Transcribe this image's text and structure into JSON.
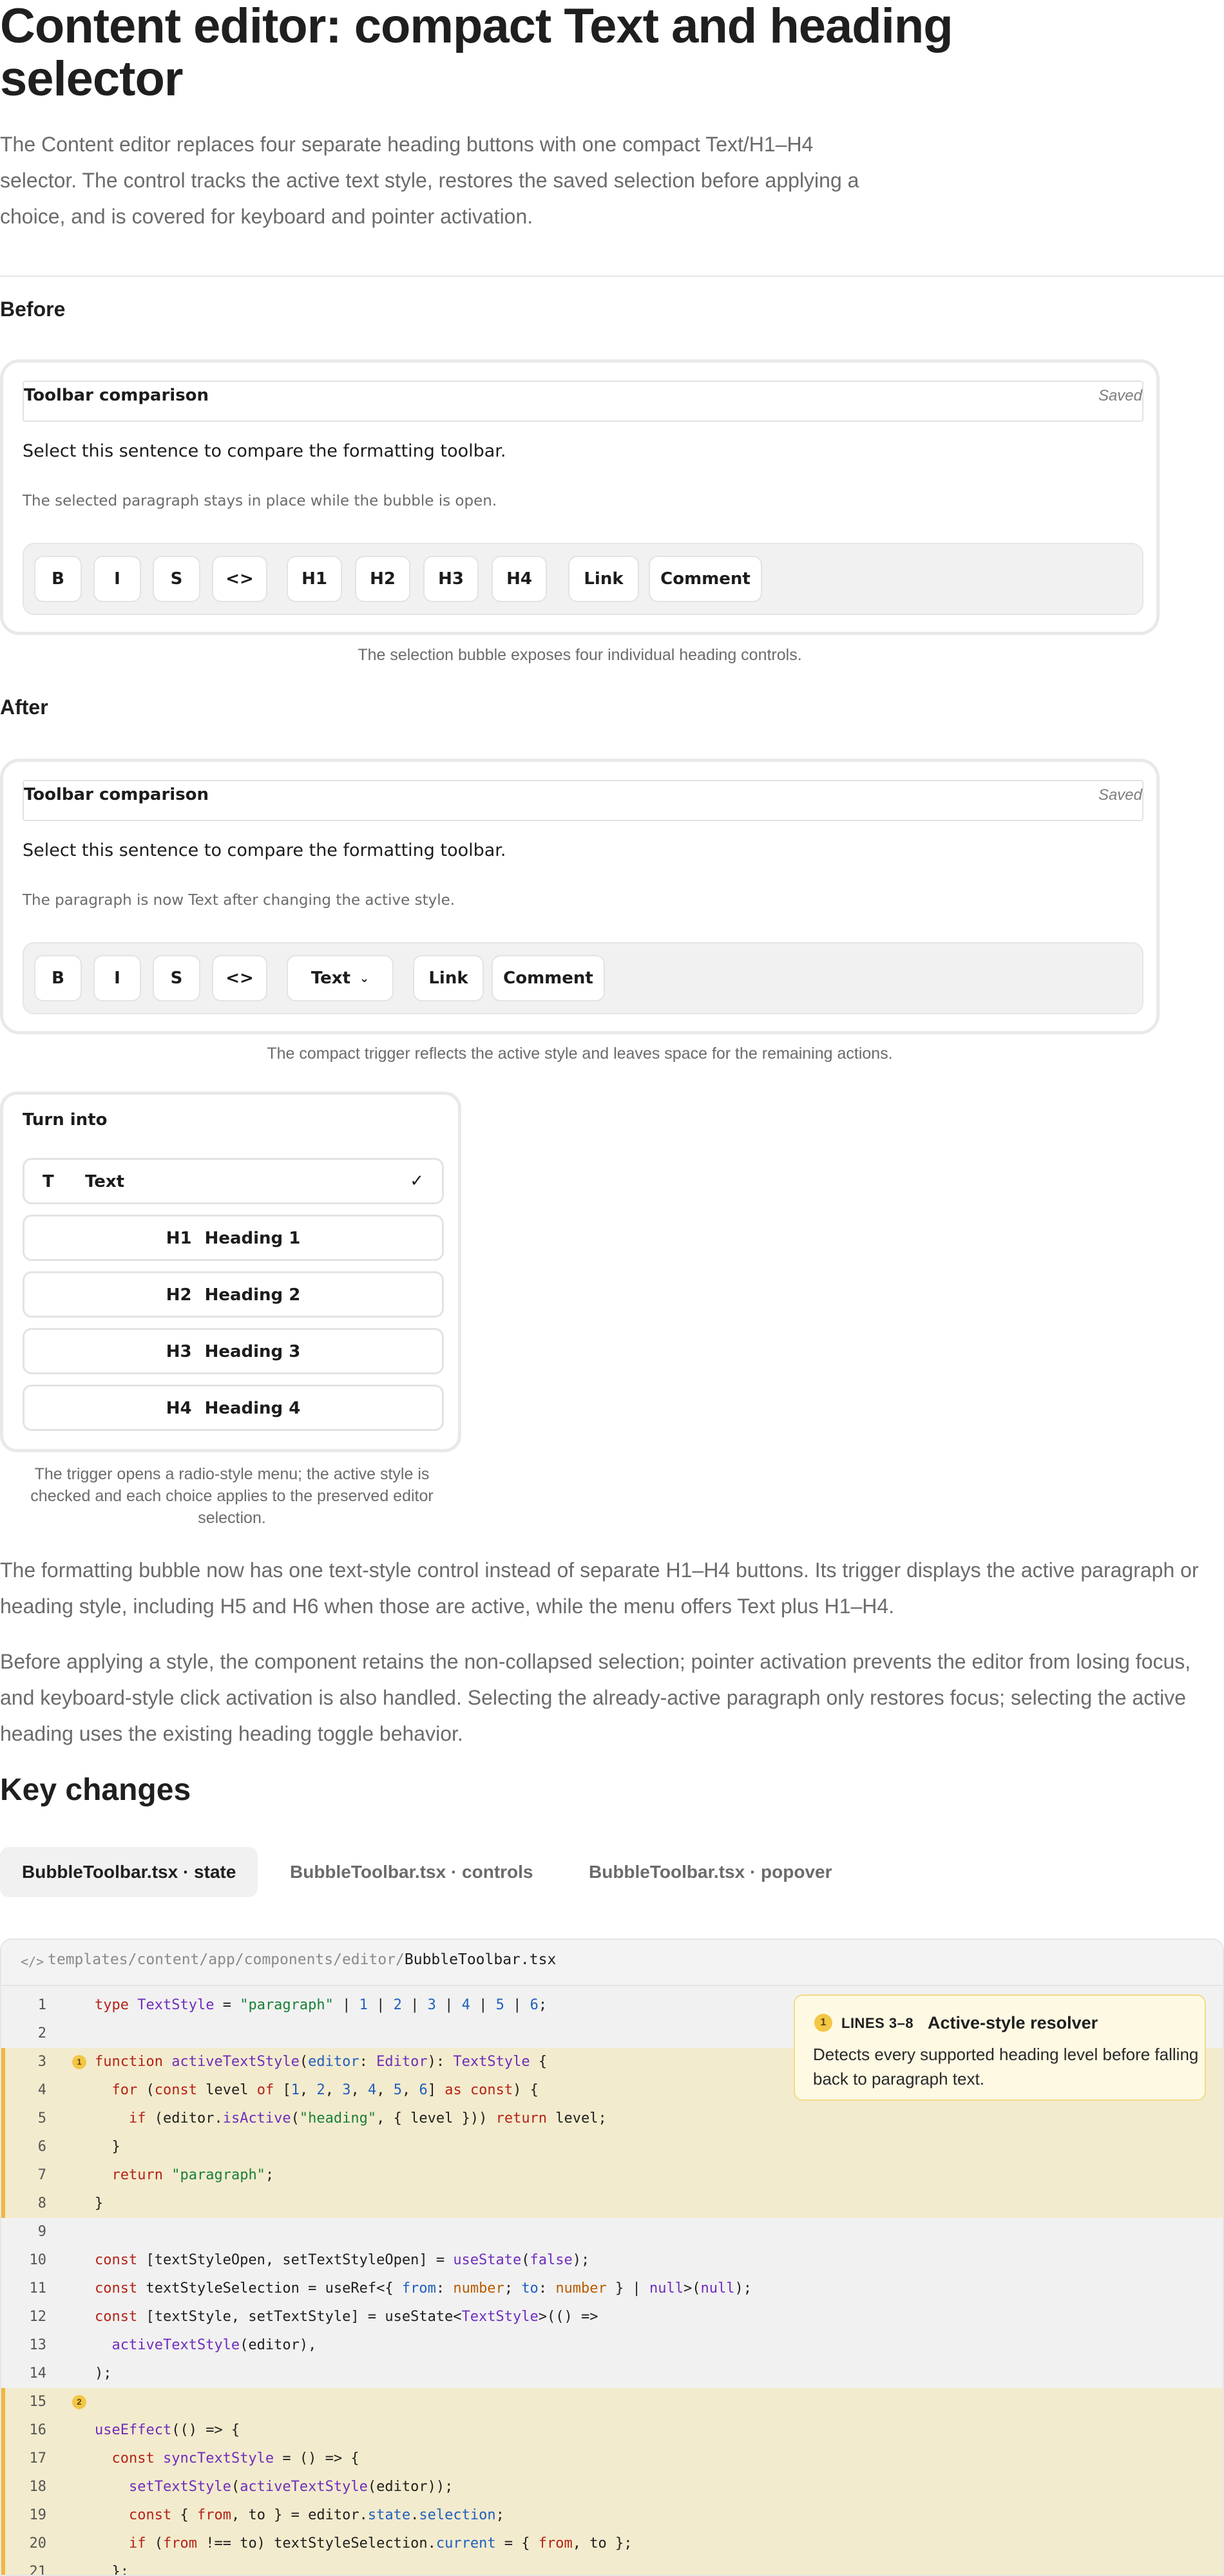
{
  "page": {
    "title": "Content editor: compact Text and heading selector",
    "intro": "The Content editor replaces four separate heading buttons with one compact Text/H1–H4 selector. The control tracks the active text style, restores the saved selection before applying a choice, and is covered for keyboard and pointer activation."
  },
  "before": {
    "label": "Before",
    "doc_title": "Toolbar comparison",
    "saved": "Saved",
    "sentence": "Select this sentence to compare the formatting toolbar.",
    "paragraph": "The selected paragraph stays in place while the bubble is open.",
    "buttons": [
      "B",
      "I",
      "S",
      "<>",
      "H1",
      "H2",
      "H3",
      "H4",
      "Link",
      "Comment"
    ],
    "caption": "The selection bubble exposes four individual heading controls."
  },
  "after": {
    "label": "After",
    "doc_title": "Toolbar comparison",
    "saved": "Saved",
    "sentence": "Select this sentence to compare the formatting toolbar.",
    "paragraph": "The paragraph is now Text after changing the active style.",
    "buttons": [
      "B",
      "I",
      "S",
      "<>",
      "Text",
      "Link",
      "Comment"
    ],
    "caption": "The compact trigger reflects the active style and leaves space for the remaining actions."
  },
  "menu": {
    "title": "Turn into",
    "items": [
      {
        "icon": "T",
        "label": "Text",
        "checked": true
      },
      {
        "icon": "H1",
        "label": "Heading 1"
      },
      {
        "icon": "H2",
        "label": "Heading 2"
      },
      {
        "icon": "H3",
        "label": "Heading 3"
      },
      {
        "icon": "H4",
        "label": "Heading 4"
      }
    ],
    "caption": "The trigger opens a radio-style menu; the active style is checked and each choice applies to the preserved editor selection."
  },
  "body": {
    "p1": "The formatting bubble now has one text-style control instead of separate H1–H4 buttons. Its trigger displays the active paragraph or heading style, including H5 and H6 when those are active, while the menu offers Text plus H1–H4.",
    "p2": "Before applying a style, the component retains the non-collapsed selection; pointer activation prevents the editor from losing focus, and keyboard-style click activation is also handled. Selecting the already-active paragraph only restores focus; selecting the active heading uses the existing heading toggle behavior."
  },
  "key_changes": {
    "heading": "Key changes",
    "tabs": [
      "BubbleToolbar.tsx · state",
      "BubbleToolbar.tsx · controls",
      "BubbleToolbar.tsx · popover"
    ],
    "active_tab": 0
  },
  "code": {
    "path_prefix": "templates/content/app/components/editor/",
    "file": "BubbleToolbar.tsx",
    "icon": "code-icon",
    "note": {
      "badge": "1",
      "lines": "LINES 3–8",
      "title": "Active-style resolver",
      "text": "Detects every supported heading level before falling back to paragraph text."
    },
    "markers": [
      "1",
      "2"
    ],
    "line_numbers": [
      "1",
      "2",
      "3",
      "4",
      "5",
      "6",
      "7",
      "8",
      "9",
      "10",
      "11",
      "12",
      "13",
      "14",
      "15",
      "16",
      "17",
      "18",
      "19",
      "20",
      "21"
    ]
  },
  "colors": {
    "highlight": "#f3ebcd",
    "highlight_bar": "#f0b73c",
    "badge": "#f3c645",
    "keyword": "#b42318",
    "type": "#6f2dbd",
    "string": "#1a7f37",
    "number": "#1f5fbf"
  }
}
